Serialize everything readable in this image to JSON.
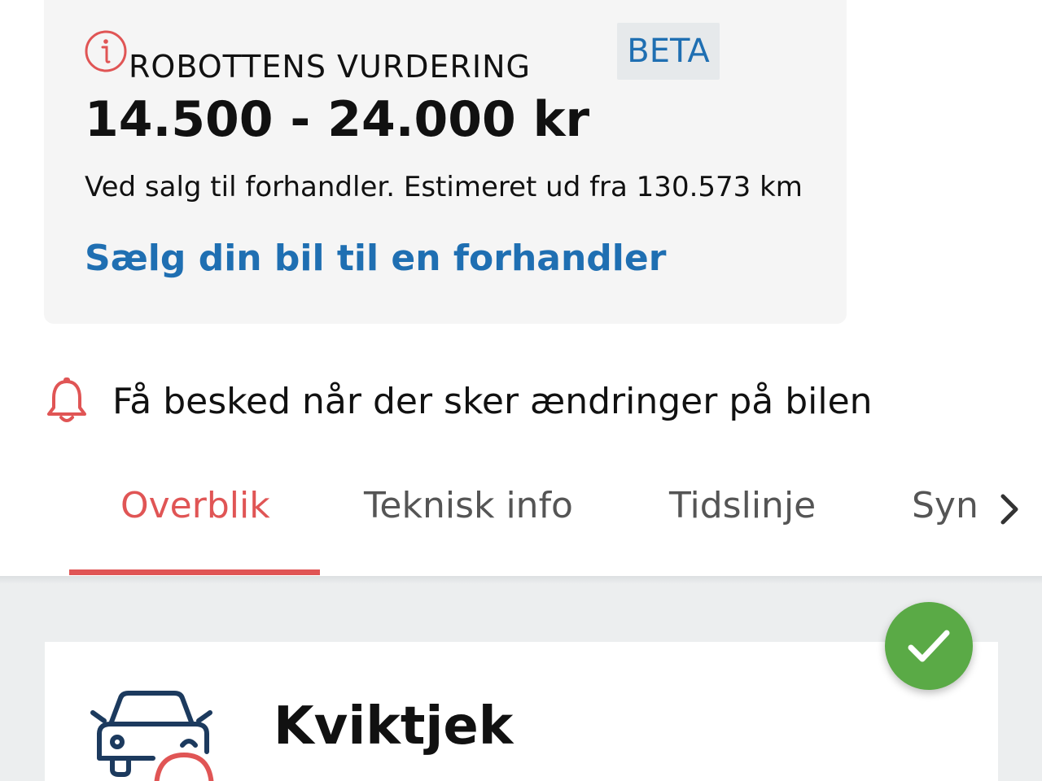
{
  "valuation": {
    "title": "ROBOTTENS VURDERING",
    "badge": "BETA",
    "price_range": "14.500 - 24.000 kr",
    "note": "Ved salg til forhandler. Estimeret ud fra 130.573 km",
    "sell_link": "Sælg din bil til en forhandler"
  },
  "notify": {
    "label": "Få besked når der sker ændringer på bilen"
  },
  "tabs": [
    {
      "label": "Overblik",
      "active": true
    },
    {
      "label": "Teknisk info",
      "active": false
    },
    {
      "label": "Tidslinje",
      "active": false
    },
    {
      "label": "Syn",
      "active": false
    }
  ],
  "quickcheck": {
    "title": "Kviktjek",
    "status": "ok"
  },
  "colors": {
    "accent_red": "#e05555",
    "link_blue": "#1f6fb2",
    "success_green": "#5aaa46"
  }
}
